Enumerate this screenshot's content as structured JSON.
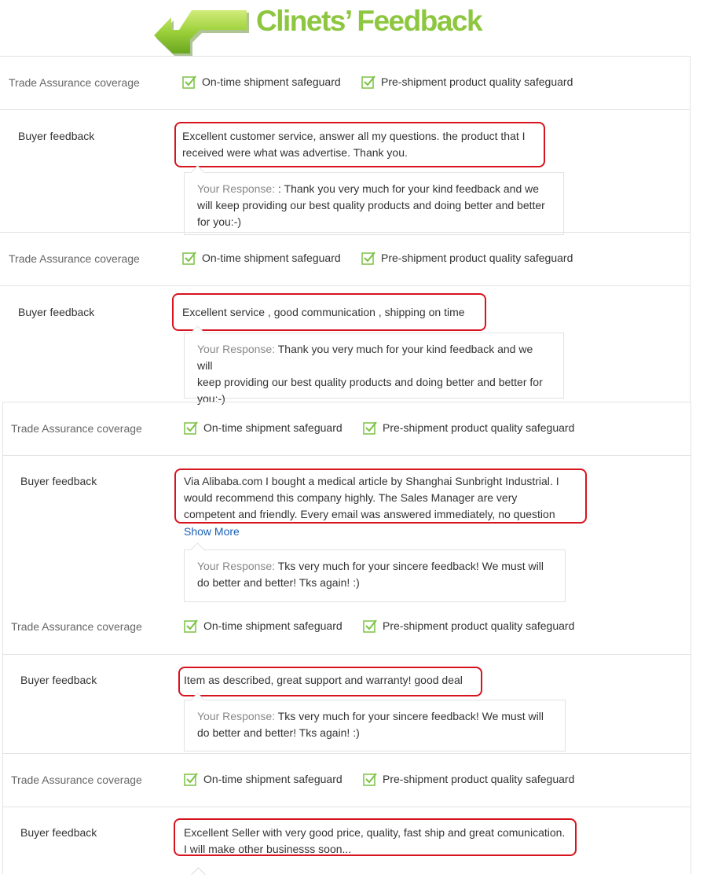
{
  "header": {
    "title": "Clinets’ Feedback"
  },
  "colors": {
    "accent": "#8dc63f",
    "highlight": "#d7141e",
    "link": "#1a5fb4"
  },
  "trade": {
    "label": "Trade Assurance coverage",
    "item1": "On-time shipment safeguard",
    "item2": "Pre-shipment product quality safeguard"
  },
  "feedback_label": "Buyer feedback",
  "response_label": "Your Response:",
  "entries": [
    {
      "comment_lines": [
        "Excellent customer service, answer all my questions. the product that I",
        "received were what was advertise. Thank you."
      ],
      "response_lines": [
        ": Thank you very much for your kind feedback and we",
        "will keep providing our best quality products and doing better and better",
        "for you:-)"
      ]
    },
    {
      "comment_lines": [
        "Excellent service , good communication , shipping on time"
      ],
      "response_lines": [
        "Thank you very much for your kind feedback and we will",
        "keep providing our best quality products and doing better and better for",
        "you:-)"
      ]
    },
    {
      "comment_lines": [
        "Via Alibaba.com I bought a medical article by Shanghai Sunbright Industrial. I",
        "would recommend this company highly. The Sales Manager are very",
        "competent and friendly. Every email was answered immediately, no question"
      ],
      "show_more": "Show More",
      "response_lines": [
        "Tks very much for your sincere feedback! We must will",
        "do better and better! Tks again! :)"
      ]
    },
    {
      "comment_lines": [
        "Item as described, great support and warranty! good deal"
      ],
      "response_lines": [
        "Tks very much for your sincere feedback! We must will",
        "do better and better! Tks again! :)"
      ]
    },
    {
      "comment_lines": [
        "Excellent Seller with very good price, quality, fast ship and great comunication.",
        "I will make other businesss soon..."
      ]
    }
  ]
}
